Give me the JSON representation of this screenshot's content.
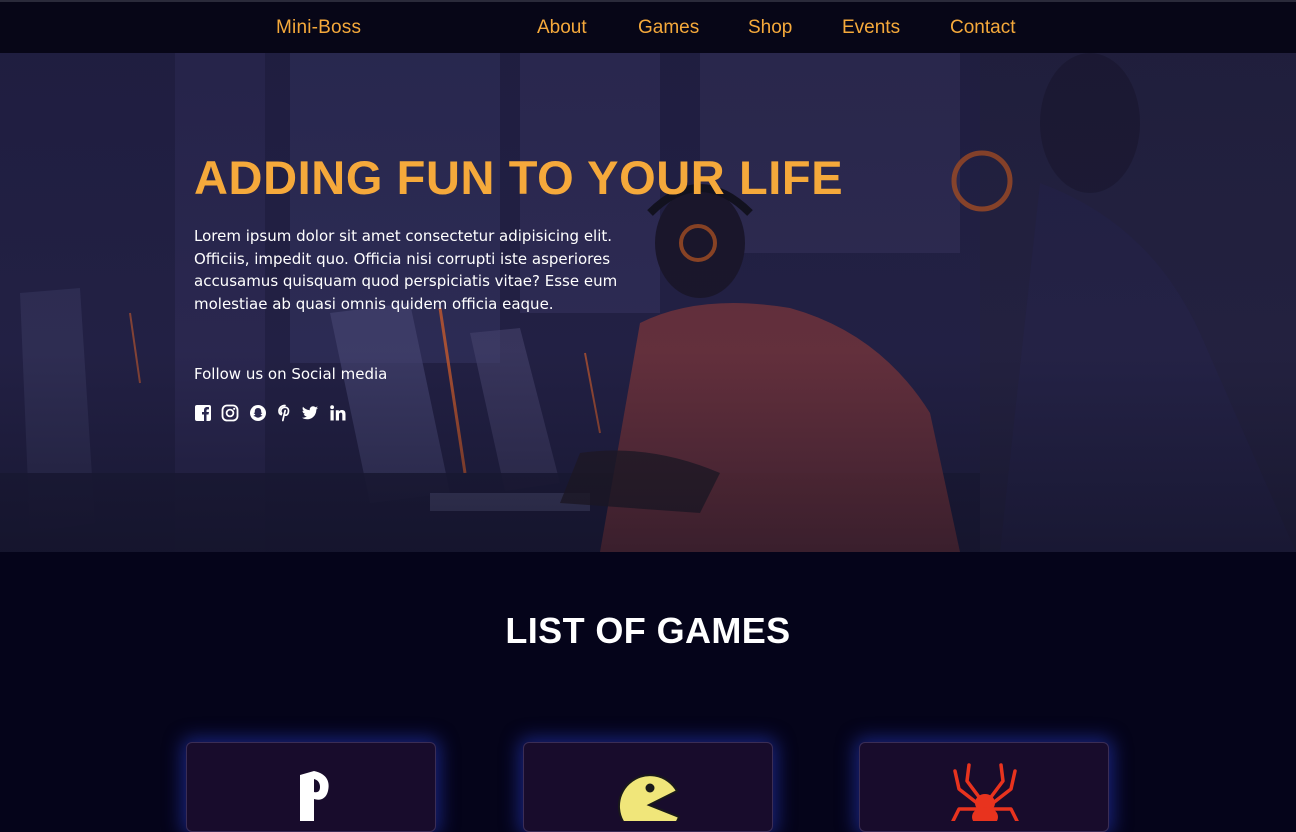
{
  "header": {
    "brand": "Mini-Boss",
    "nav": [
      "About",
      "Games",
      "Shop",
      "Events",
      "Contact"
    ]
  },
  "hero": {
    "title": "ADDING FUN TO YOUR LIFE",
    "text": "Lorem ipsum dolor sit amet consectetur adipisicing elit. Officiis, impedit quo. Officia nisi corrupti iste asperiores accusamus quisquam quod perspiciatis vitae? Esse eum molestiae ab quasi omnis quidem officia eaque.",
    "follow": "Follow us on Social media",
    "socials": [
      "facebook-icon",
      "instagram-icon",
      "snapchat-icon",
      "pinterest-icon",
      "twitter-icon",
      "linkedin-icon"
    ]
  },
  "games": {
    "title": "LIST OF GAMES",
    "cards": [
      "playstation-logo",
      "pacman-logo",
      "spider-logo"
    ]
  },
  "colors": {
    "accent": "#f5a93b",
    "background": "#05041a",
    "card": "#180c2c",
    "glow": "#3c50ff"
  }
}
